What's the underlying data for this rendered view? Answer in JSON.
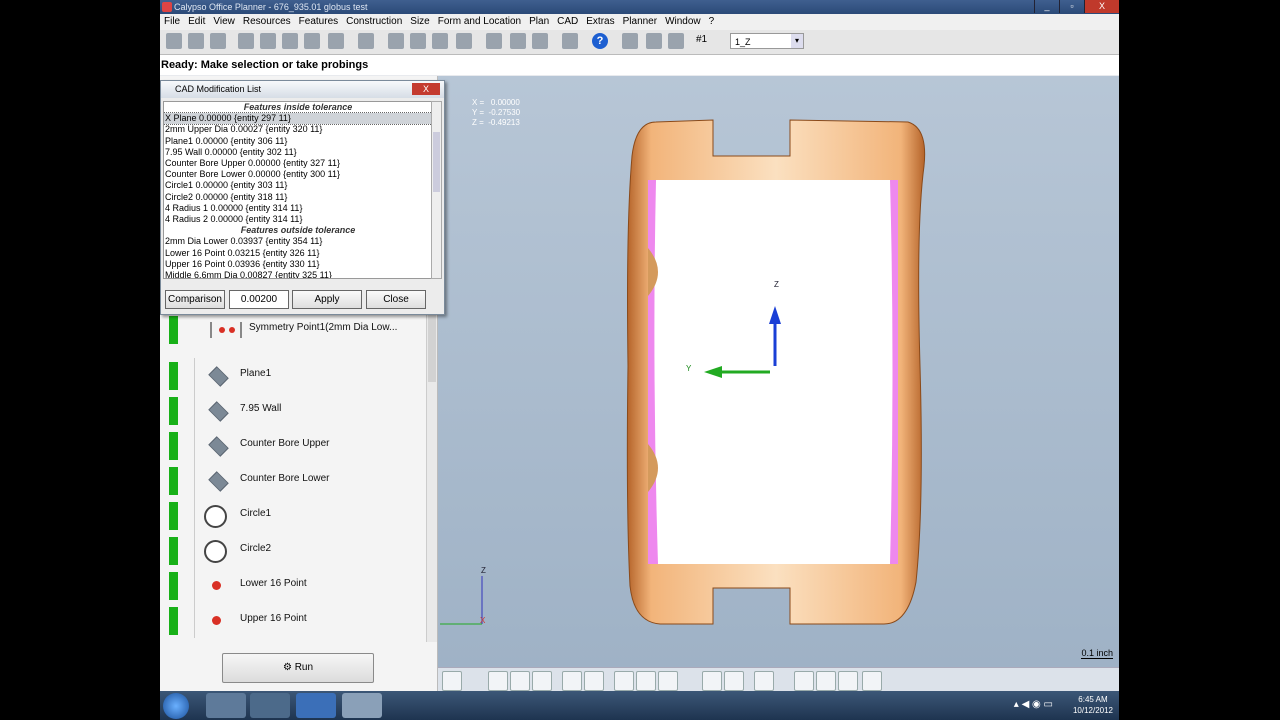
{
  "window": {
    "title": "Calypso Office Planner - 676_935.01 globus test",
    "min": "_",
    "max": "▫",
    "close": "X"
  },
  "menu": [
    "File",
    "Edit",
    "View",
    "Resources",
    "Features",
    "Construction",
    "Size",
    "Form and Location",
    "Plan",
    "CAD",
    "Extras",
    "Planner",
    "Window",
    "?"
  ],
  "toolbar": {
    "alignment": "#1",
    "combo_value": "1_Z",
    "combo_arrow": "▾",
    "help_label": "?"
  },
  "status": "Ready: Make selection or take probings",
  "dialog": {
    "title": "CAD Modification List",
    "close": "X",
    "header_inside": "Features inside tolerance",
    "inside": [
      "X Plane       0.00000  {entity 297 11}",
      "2mm Upper Dia       0.00027  {entity 320 11}",
      "Plane1   0.00000  {entity 306 11}",
      "7.95 Wall    0.00000  {entity 302 11}",
      "Counter Bore Upper       0.00000  {entity 327 11}",
      "Counter Bore Lower       0.00000  {entity 300 11}",
      "Circle1   0.00000  {entity 303 11}",
      "Circle2   0.00000  {entity 318 11}",
      "4 Radius 1    0.00000  {entity 314 11}",
      "4 Radius 2    0.00000  {entity 314 11}"
    ],
    "header_outside": "Features outside tolerance",
    "outside": [
      "2mm Dia Lower       0.03937  {entity 354 11}",
      "Lower 16 Point       0.03215  {entity 326 11}",
      "Upper 16 Point       0.03936  {entity 330 11}",
      "Middle 6.6mm Dia     0.00827  {entity 325 11}"
    ],
    "comparison_label": "Comparison",
    "comparison_value": "0.00200",
    "apply": "Apply",
    "close_btn": "Close"
  },
  "features": {
    "symmetry": "Symmetry Point1(2mm Dia Low...",
    "items": [
      {
        "label": "Plane1",
        "icon": "plane-icon"
      },
      {
        "label": "7.95 Wall",
        "icon": "plane-icon"
      },
      {
        "label": "Counter Bore Upper",
        "icon": "plane-icon"
      },
      {
        "label": "Counter Bore Lower",
        "icon": "plane-icon"
      },
      {
        "label": "Circle1",
        "icon": "circle-icon"
      },
      {
        "label": "Circle2",
        "icon": "circle-icon"
      },
      {
        "label": "Lower 16 Point",
        "icon": "point-icon"
      },
      {
        "label": "Upper 16 Point",
        "icon": "point-icon"
      }
    ]
  },
  "run": "Run",
  "viewport": {
    "coords": "X =   0.00000\nY =  -0.27530\nZ =  -0.49213",
    "scale": "0.1 inch",
    "axis_z": "Z",
    "axis_y": "Y",
    "triad_z": "Z",
    "triad_x": "X"
  },
  "tray": {
    "time": "6:45 AM",
    "date": "10/12/2012"
  },
  "colors": {
    "part": "#e8a868",
    "magenta": "#ee88ee",
    "axis_green": "#22aa22",
    "axis_blue": "#1a3fd6"
  }
}
